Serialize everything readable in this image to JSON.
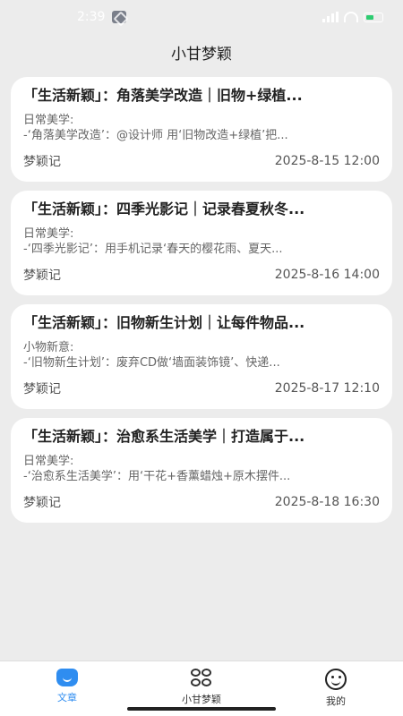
{
  "status_bar": {
    "time": "2:39",
    "battery_color": "#2ecc71"
  },
  "header": {
    "title": "小甘梦颖"
  },
  "articles": [
    {
      "title": "「生活新颖」：角落美学改造｜旧物+绿植...",
      "category": "日常美学:",
      "summary": "-‘角落美学改造’：@设计师 用‘旧物改造+绿植’把...",
      "author": "梦颖记",
      "date": "2025-8-15 12:00"
    },
    {
      "title": "「生活新颖」：四季光影记｜记录春夏秋冬...",
      "category": "日常美学:",
      "summary": "-‘四季光影记’：用手机记录‘春天的樱花雨、夏天...",
      "author": "梦颖记",
      "date": "2025-8-16 14:00"
    },
    {
      "title": "「生活新颖」：旧物新生计划｜让每件物品...",
      "category": "小物新意:",
      "summary": "-‘旧物新生计划’：废弃CD做‘墙面装饰镜’、快递...",
      "author": "梦颖记",
      "date": "2025-8-17 12:10"
    },
    {
      "title": "「生活新颖」：治愈系生活美学｜打造属于...",
      "category": "日常美学:",
      "summary": "-‘治愈系生活美学’：用‘干花+香薰蜡烛+原木摆件...",
      "author": "梦颖记",
      "date": "2025-8-18 16:30"
    }
  ],
  "tabs": [
    {
      "label": "文章",
      "icon": "article-icon",
      "active": true,
      "color": "#2f8df0"
    },
    {
      "label": "小甘梦颖",
      "icon": "clover-grid-icon",
      "active": false
    },
    {
      "label": "我的",
      "icon": "smile-icon",
      "active": false
    }
  ]
}
